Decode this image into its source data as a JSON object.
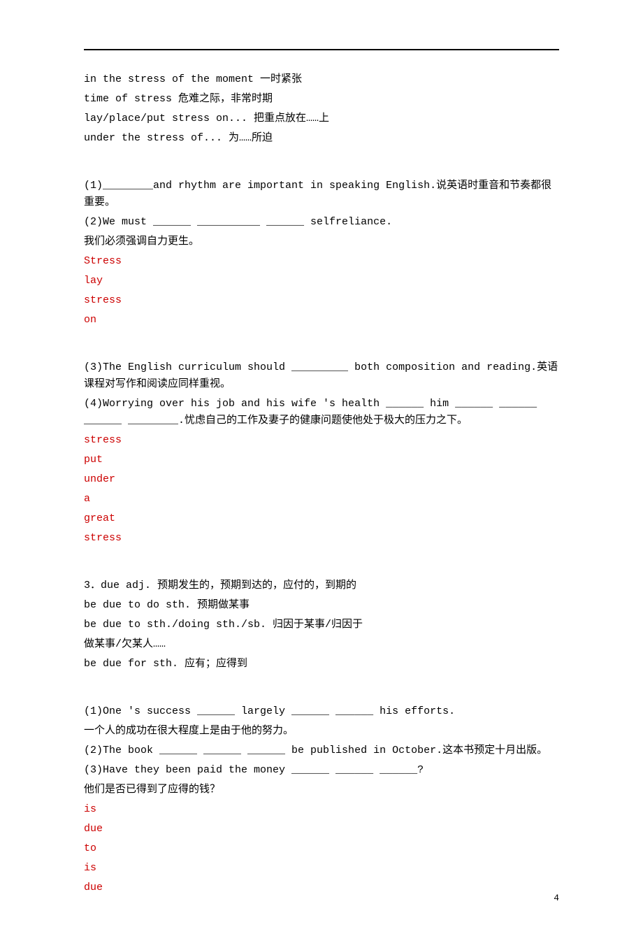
{
  "lines": [
    {
      "text": "in the stress of the moment 一时紧张",
      "red": false
    },
    {
      "text": "time of stress 危难之际，非常时期",
      "red": false
    },
    {
      "text": "lay/place/put stress on... 把重点放在……上",
      "red": false
    },
    {
      "text": "under the stress of... 为……所迫",
      "red": false
    },
    {
      "gap": true
    },
    {
      "gap": true
    },
    {
      "text": "(1)________and rhythm are important in speaking English.说英语时重音和节奏都很重要。",
      "red": false
    },
    {
      "text": "(2)We must ______ __________ ______ selfreliance.",
      "red": false
    },
    {
      "text": "我们必须强调自力更生。",
      "red": false
    },
    {
      "text": "Stress",
      "red": true
    },
    {
      "text": "lay",
      "red": true
    },
    {
      "text": "stress",
      "red": true
    },
    {
      "text": "on",
      "red": true
    },
    {
      "gap": true
    },
    {
      "gap": true
    },
    {
      "text": "(3)The English curriculum should _________ both composition and reading.英语课程对写作和阅读应同样重视。",
      "red": false
    },
    {
      "text": "(4)Worrying over his job and his wife 's health ______ him ______ ______ ______ ________.忧虑自己的工作及妻子的健康问题使他处于极大的压力之下。",
      "red": false
    },
    {
      "text": "stress",
      "red": true
    },
    {
      "text": "put",
      "red": true
    },
    {
      "text": "under",
      "red": true
    },
    {
      "text": "a",
      "red": true
    },
    {
      "text": "great",
      "red": true
    },
    {
      "text": "stress",
      "red": true
    },
    {
      "gap": true
    },
    {
      "gap": true
    },
    {
      "text": "3．due adj. 预期发生的，预期到达的，应付的，到期的",
      "red": false
    },
    {
      "text": "be due to do sth. 预期做某事",
      "red": false
    },
    {
      "text": "be due to sth./doing sth./sb. 归因于某事/归因于",
      "red": false
    },
    {
      "text": "做某事/欠某人……",
      "red": false
    },
    {
      "text": "be due for sth. 应有；应得到",
      "red": false
    },
    {
      "gap": true
    },
    {
      "gap": true
    },
    {
      "text": "(1)One 's success ______ largely ______ ______ his efforts.",
      "red": false
    },
    {
      "text": "一个人的成功在很大程度上是由于他的努力。",
      "red": false
    },
    {
      "text": "(2)The book ______ ______ ______ be published in October.这本书预定十月出版。",
      "red": false
    },
    {
      "text": "(3)Have they been paid the money ______ ______ ______?",
      "red": false
    },
    {
      "text": "他们是否已得到了应得的钱？",
      "red": false
    },
    {
      "text": "is",
      "red": true
    },
    {
      "text": "due",
      "red": true
    },
    {
      "text": "to",
      "red": true
    },
    {
      "text": "is",
      "red": true
    },
    {
      "text": "due",
      "red": true
    }
  ],
  "page_number": "4"
}
